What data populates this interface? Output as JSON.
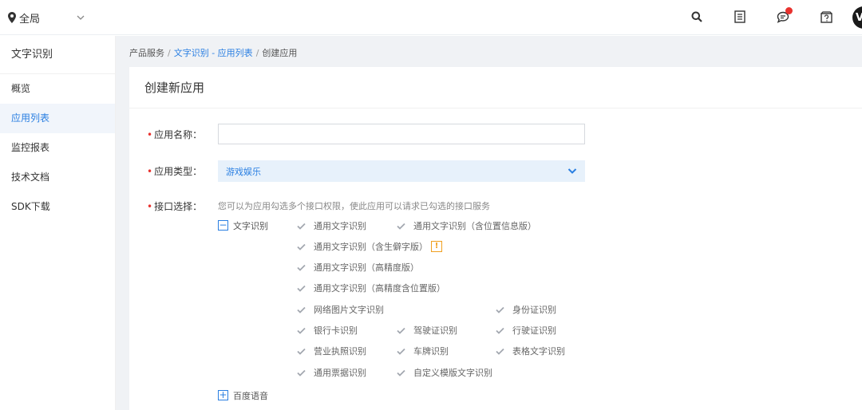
{
  "topbar": {
    "region_label": "全局",
    "icons": [
      "search-icon",
      "document-list-icon",
      "message-icon",
      "help-icon"
    ],
    "avatar_letter": "V"
  },
  "sidebar": {
    "title": "文字识别",
    "items": [
      {
        "label": "概览",
        "active": false
      },
      {
        "label": "应用列表",
        "active": true
      },
      {
        "label": "监控报表",
        "active": false
      },
      {
        "label": "技术文档",
        "active": false
      },
      {
        "label": "SDK下载",
        "active": false
      }
    ]
  },
  "breadcrumb": {
    "root": "产品服务",
    "link": "文字识别 - 应用列表",
    "current": "创建应用",
    "separator": "/"
  },
  "card": {
    "title": "创建新应用"
  },
  "form": {
    "required_mark": "•",
    "app_name_label": "应用名称：",
    "app_name_value": "",
    "app_type_label": "应用类型：",
    "app_type_value": "游戏娱乐",
    "api_label": "接口选择：",
    "api_hint": "您可以为应用勾选多个接口权限，使此应用可以请求已勾选的接口服务",
    "groups": [
      {
        "label": "文字识别",
        "toggle": "−",
        "expanded": true,
        "options": [
          "通用文字识别",
          "通用文字识别（含位置信息版）",
          "通用文字识别（含生僻字版）",
          "通用文字识别（高精度版）",
          "通用文字识别（高精度含位置版）",
          "网络图片文字识别",
          "身份证识别",
          "银行卡识别",
          "驾驶证识别",
          "行驶证识别",
          "营业执照识别",
          "车牌识别",
          "表格文字识别",
          "通用票据识别",
          "自定义模版文字识别"
        ],
        "warning_mark": "!"
      },
      {
        "label": "百度语音",
        "toggle": "+",
        "expanded": false
      }
    ]
  },
  "colors": {
    "accent": "#2a7fe2",
    "required": "#e8322e",
    "select_bg": "#e7f1fb",
    "warning": "#f0a020",
    "page_bg": "#f0f2f5"
  }
}
